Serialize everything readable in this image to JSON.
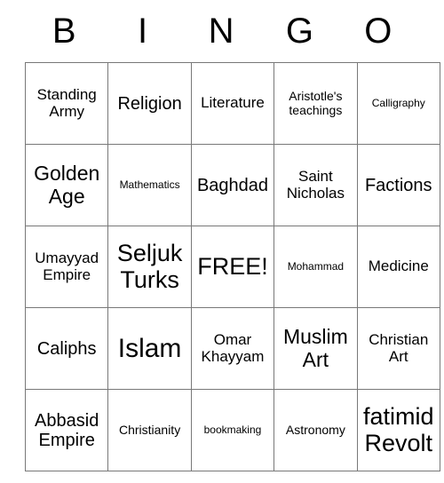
{
  "card": {
    "header_letters": [
      "B",
      "I",
      "N",
      "G",
      "O"
    ],
    "free_space_label": "FREE!",
    "colors": {
      "background": "#ffffff",
      "border": "#787878",
      "text": "#000000"
    },
    "rows": [
      [
        {
          "label": "Standing Army",
          "size": "md"
        },
        {
          "label": "Religion",
          "size": "lg"
        },
        {
          "label": "Literature",
          "size": "md"
        },
        {
          "label": "Aristotle's teachings",
          "size": "sm"
        },
        {
          "label": "Calligraphy",
          "size": "xs"
        }
      ],
      [
        {
          "label": "Golden Age",
          "size": "xl"
        },
        {
          "label": "Mathematics",
          "size": "xs"
        },
        {
          "label": "Baghdad",
          "size": "lg"
        },
        {
          "label": "Saint Nicholas",
          "size": "md"
        },
        {
          "label": "Factions",
          "size": "lg"
        }
      ],
      [
        {
          "label": "Umayyad Empire",
          "size": "md"
        },
        {
          "label": "Seljuk Turks",
          "size": "xxl"
        },
        {
          "label": "FREE!",
          "size": "xxl"
        },
        {
          "label": "Mohammad",
          "size": "xs"
        },
        {
          "label": "Medicine",
          "size": "md"
        }
      ],
      [
        {
          "label": "Caliphs",
          "size": "lg"
        },
        {
          "label": "Islam",
          "size": "xxxl"
        },
        {
          "label": "Omar Khayyam",
          "size": "md"
        },
        {
          "label": "Muslim Art",
          "size": "xl"
        },
        {
          "label": "Christian Art",
          "size": "md"
        }
      ],
      [
        {
          "label": "Abbasid Empire",
          "size": "lg"
        },
        {
          "label": "Christianity",
          "size": "sm"
        },
        {
          "label": "bookmaking",
          "size": "xs"
        },
        {
          "label": "Astronomy",
          "size": "sm"
        },
        {
          "label": "fatimid Revolt",
          "size": "xxl"
        }
      ]
    ]
  }
}
